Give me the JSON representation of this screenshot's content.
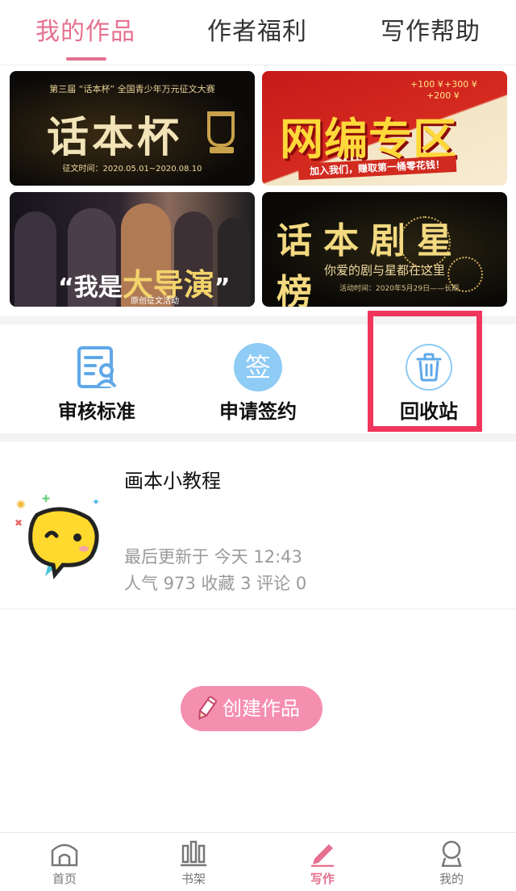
{
  "tabs": [
    {
      "label": "我的作品",
      "active": true
    },
    {
      "label": "作者福利",
      "active": false
    },
    {
      "label": "写作帮助",
      "active": false
    }
  ],
  "banners": {
    "b1": {
      "caption": "第三届 “话本杯” 全国青少年万元征文大赛",
      "title": "话本杯",
      "date": "征文时间：2020.05.01~2020.08.10"
    },
    "b2": {
      "title": "网编专区",
      "money1": "+100 ¥",
      "money2": "+300 ¥",
      "money3": "+200 ¥",
      "ribbon": "加入我们，赚取第一桶零花钱！"
    },
    "b3": {
      "prefix": "“我是",
      "highlight": "大导演",
      "suffix": "”",
      "sub": "原创征文活动"
    },
    "b4": {
      "title": "话本剧星榜",
      "sub": "你爱的剧与星都在这里",
      "date": "活动时间：2020年5月29日——长期"
    }
  },
  "actions": [
    {
      "label": "审核标准",
      "icon": "review-document-icon"
    },
    {
      "label": "申请签约",
      "icon": "sign-contract-icon",
      "icon_text": "签"
    },
    {
      "label": "回收站",
      "icon": "trash-icon"
    }
  ],
  "work": {
    "title": "画本小教程",
    "updated": "最后更新于 今天 12:43",
    "stats": "人气 973 收藏 3 评论 0"
  },
  "create_button": {
    "label": "创建作品"
  },
  "bottom_nav": [
    {
      "label": "首页",
      "icon": "home-icon"
    },
    {
      "label": "书架",
      "icon": "bookshelf-icon"
    },
    {
      "label": "写作",
      "icon": "pencil-icon",
      "active": true
    },
    {
      "label": "我的",
      "icon": "profile-icon"
    }
  ],
  "colors": {
    "accent": "#e5708f",
    "highlight": "#f0365c",
    "icon_blue": "#5fa8e8"
  }
}
